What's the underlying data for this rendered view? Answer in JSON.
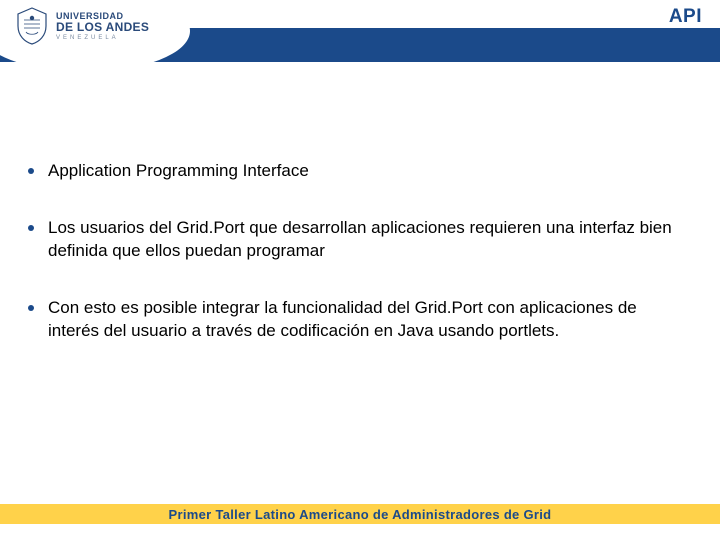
{
  "header": {
    "title": "API",
    "logo": {
      "line1": "UNIVERSIDAD",
      "line2": "DE LOS ANDES",
      "line3": "VENEZUELA"
    }
  },
  "bullets": [
    "Application Programming Interface",
    "Los usuarios del Grid.Port que desarrollan aplicaciones requieren una interfaz bien definida que ellos puedan programar",
    "Con esto es posible integrar la funcionalidad del Grid.Port con aplicaciones de interés del usuario a través de codificación en Java usando portlets."
  ],
  "footer": {
    "text": "Primer Taller Latino Americano de Administradores de Grid"
  },
  "colors": {
    "header_bar": "#1b4a8a",
    "footer_bar": "#ffd24a",
    "title_text": "#1b4a8a"
  }
}
